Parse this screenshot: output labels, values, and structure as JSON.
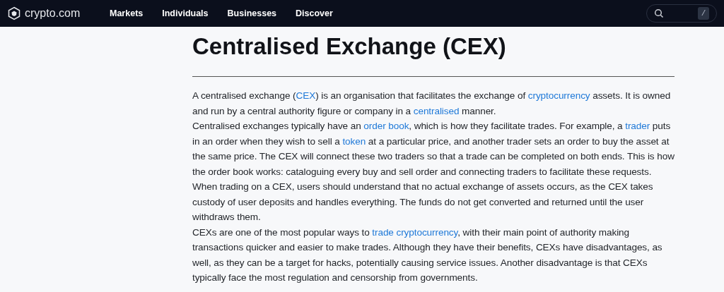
{
  "header": {
    "logo_text": "crypto.com",
    "nav": [
      {
        "label": "Markets"
      },
      {
        "label": "Individuals"
      },
      {
        "label": "Businesses"
      },
      {
        "label": "Discover"
      }
    ],
    "search": {
      "shortcut": "/"
    }
  },
  "article": {
    "title": "Centralised Exchange (CEX)",
    "paragraphs": [
      [
        {
          "kind": "text",
          "text": "A centralised exchange ("
        },
        {
          "kind": "link",
          "text": "CEX"
        },
        {
          "kind": "text",
          "text": ") is an organisation that facilitates the exchange of "
        },
        {
          "kind": "link",
          "text": "cryptocurrency"
        },
        {
          "kind": "text",
          "text": " assets. It is owned and run by a central authority figure or company in a "
        },
        {
          "kind": "link",
          "text": "centralised"
        },
        {
          "kind": "text",
          "text": " manner."
        }
      ],
      [
        {
          "kind": "text",
          "text": "Centralised exchanges typically have an "
        },
        {
          "kind": "link",
          "text": "order book"
        },
        {
          "kind": "text",
          "text": ", which is how they facilitate trades. For example, a "
        },
        {
          "kind": "link",
          "text": "trader"
        },
        {
          "kind": "text",
          "text": " puts in an order when they wish to sell a "
        },
        {
          "kind": "link",
          "text": "token"
        },
        {
          "kind": "text",
          "text": " at a particular price, and another trader sets an order to buy the asset at the same price. The CEX will connect these two traders so that a trade can be completed on both ends. This is how the order book works: cataloguing every buy and sell order and connecting traders to facilitate these requests."
        }
      ],
      [
        {
          "kind": "text",
          "text": "When trading on a CEX, users should understand that no actual exchange of assets occurs, as the CEX takes custody of user deposits and handles everything. The funds do not get converted and returned until the user withdraws them."
        }
      ],
      [
        {
          "kind": "text",
          "text": "CEXs are one of the most popular ways to "
        },
        {
          "kind": "link",
          "text": "trade cryptocurrency"
        },
        {
          "kind": "text",
          "text": ", with their main point of authority making transactions quicker and easier to make trades. Although they have their benefits, CEXs have disadvantages, as well, as they can be a target for hacks, potentially causing service issues. Another disadvantage is that CEXs typically face the most regulation and censorship from governments."
        }
      ]
    ]
  }
}
